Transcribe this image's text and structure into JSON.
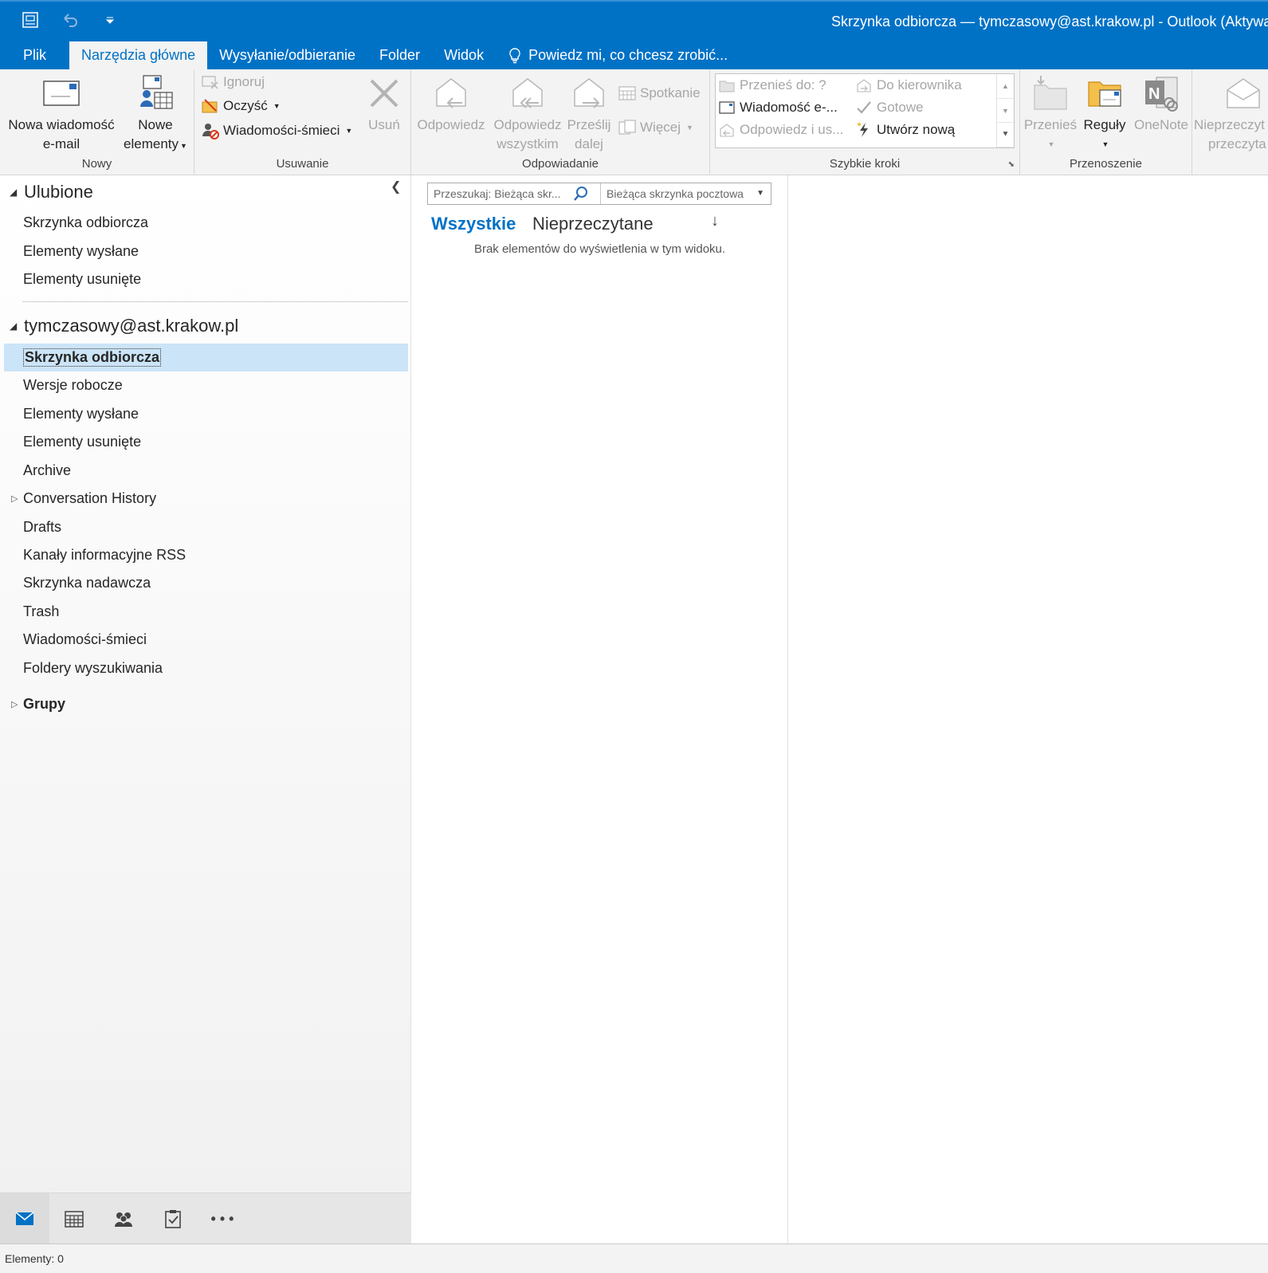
{
  "window": {
    "title": "Skrzynka odbiorcza — tymczasowy@ast.krakow.pl - Outlook (Aktywa"
  },
  "qat": {
    "icons": [
      "send-receive-icon",
      "undo-icon",
      "customize-qat-icon"
    ]
  },
  "tabs": [
    {
      "label": "Plik"
    },
    {
      "label": "Narzędzia główne"
    },
    {
      "label": "Wysyłanie/odbieranie"
    },
    {
      "label": "Folder"
    },
    {
      "label": "Widok"
    },
    {
      "label": "Powiedz mi, co chcesz zrobić..."
    }
  ],
  "ribbon": {
    "nowy": {
      "label": "Nowy",
      "new_email_line1": "Nowa wiadomość",
      "new_email_line2": "e-mail",
      "new_items_line1": "Nowe",
      "new_items_line2": "elementy"
    },
    "usuwanie": {
      "label": "Usuwanie",
      "ignore": "Ignoruj",
      "clean": "Oczyść",
      "junk": "Wiadomości-śmieci",
      "delete": "Usuń"
    },
    "odpowiadanie": {
      "label": "Odpowiadanie",
      "reply": "Odpowiedz",
      "reply_all_line1": "Odpowiedz",
      "reply_all_line2": "wszystkim",
      "forward_line1": "Prześlij",
      "forward_line2": "dalej",
      "meeting": "Spotkanie",
      "more": "Więcej"
    },
    "szybkie_kroki": {
      "label": "Szybkie kroki",
      "move_to": "Przenieś do: ?",
      "email": "Wiadomość e-...",
      "reply_delete": "Odpowiedz i us...",
      "to_manager": "Do kierownika",
      "done": "Gotowe",
      "create_new": "Utwórz nową"
    },
    "przenoszenie": {
      "label": "Przenoszenie",
      "move": "Przenieś",
      "rules": "Reguły",
      "onenote": "OneNote"
    },
    "tagi": {
      "unread_line1": "Nieprzeczyt",
      "unread_line2": "przeczyta"
    }
  },
  "folders": {
    "favorites": {
      "header": "Ulubione",
      "items": [
        "Skrzynka odbiorcza",
        "Elementy wysłane",
        "Elementy usunięte"
      ]
    },
    "account": {
      "header": "tymczasowy@ast.krakow.pl",
      "items": [
        "Skrzynka odbiorcza",
        "Wersje robocze",
        "Elementy wysłane",
        "Elementy usunięte",
        "Archive",
        "Conversation History",
        "Drafts",
        "Kanały informacyjne RSS",
        "Skrzynka nadawcza",
        "Trash",
        "Wiadomości-śmieci",
        "Foldery wyszukiwania"
      ],
      "selected_index": 0
    },
    "groups": {
      "header": "Grupy"
    }
  },
  "navbar": {
    "items": [
      "mail-icon",
      "calendar-icon",
      "people-icon",
      "tasks-icon",
      "more-icon"
    ],
    "more_label": "• • •"
  },
  "message_list": {
    "search_placeholder": "Przeszukaj: Bieżąca skr...",
    "search_scope": "Bieżąca skrzynka pocztowa",
    "filter_all": "Wszystkie",
    "filter_unread": "Nieprzeczytane",
    "sort_glyph": "↓",
    "empty_text": "Brak elementów do wyświetlenia w tym widoku."
  },
  "status": {
    "items_count": "Elementy: 0"
  },
  "colors": {
    "accent": "#0072c6",
    "ribbon_bg": "#f3f3f3",
    "selection": "#cce4f7"
  }
}
